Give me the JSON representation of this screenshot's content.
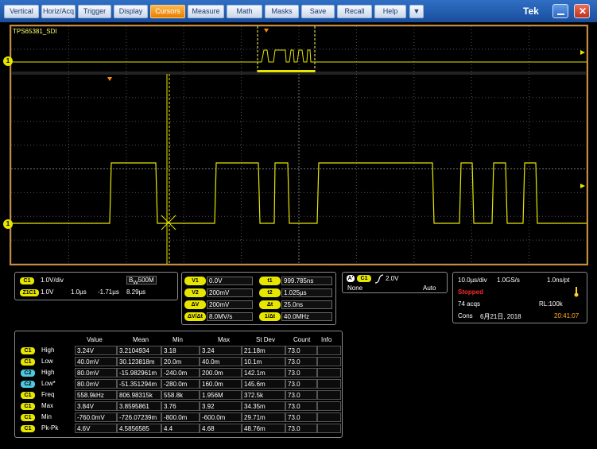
{
  "menu": [
    {
      "label": "Vertical",
      "name": "menu-vertical"
    },
    {
      "label": "Horiz/Acq",
      "name": "menu-horiz-acq"
    },
    {
      "label": "Trigger",
      "name": "menu-trigger"
    },
    {
      "label": "Display",
      "name": "menu-display"
    },
    {
      "label": "Cursors",
      "name": "menu-cursors",
      "active": true
    },
    {
      "label": "Measure",
      "name": "menu-measure"
    },
    {
      "label": "Math",
      "name": "menu-math"
    },
    {
      "label": "Masks",
      "name": "menu-masks"
    },
    {
      "label": "Save",
      "name": "menu-save"
    },
    {
      "label": "Recall",
      "name": "menu-recall"
    },
    {
      "label": "Help",
      "name": "menu-help"
    }
  ],
  "menu_more": "▼",
  "brand": "Tek",
  "screen": {
    "channel_name": "TPS65381_SDI",
    "channel_marker": "1",
    "trace_color": "#e6e600",
    "border_color": "#c88a3a"
  },
  "vertical": {
    "ch_badge": "C1",
    "volts_div": "1.0V/div",
    "bw": "500M",
    "zoom_badge": "Z1C1",
    "zoom_volts": "1.0V",
    "zoom_time": "1.0µs",
    "zoom_pos": "-1.71µs",
    "zoom_width": "8.29µs"
  },
  "cursors": {
    "v1_label": "V1",
    "v1": "0.0V",
    "v2_label": "V2",
    "v2": "200mV",
    "dv_label": "ΔV",
    "dv": "200mV",
    "dvdt_label": "ΔV/Δt",
    "dvdt": "8.0MV/s",
    "t1_label": "t1",
    "t1": "999.785ns",
    "t2_label": "t2",
    "t2": "1.025µs",
    "dt_label": "Δt",
    "dt": "25.0ns",
    "inv_dt_label": "1/Δt",
    "inv_dt": "40.0MHz"
  },
  "trigger": {
    "source_badge_a": "A'",
    "source_badge": "C1",
    "level": "2.0V",
    "mode_left": "None",
    "mode_right": "Auto"
  },
  "acquisition": {
    "timebase": "10.0µs/div",
    "sample_rate": "1.0GS/s",
    "resolution": "1.0ns/pt",
    "state": "Stopped",
    "acqs": "74 acqs",
    "record_length": "RL:100k",
    "mode": "Cons",
    "date": "6月21日, 2018",
    "time": "20:41:07"
  },
  "measurements": {
    "headers": [
      "Value",
      "Mean",
      "Min",
      "Max",
      "St Dev",
      "Count",
      "Info"
    ],
    "rows": [
      {
        "ch": "C1",
        "name": "High",
        "value": "3.24V",
        "mean": "3.2104934",
        "min": "3.18",
        "max": "3.24",
        "stdev": "21.18m",
        "count": "73.0"
      },
      {
        "ch": "C1",
        "name": "Low",
        "value": "40.0mV",
        "mean": "30.123818m",
        "min": "20.0m",
        "max": "40.0m",
        "stdev": "10.1m",
        "count": "73.0"
      },
      {
        "ch": "C2",
        "name": "High",
        "value": "80.0mV",
        "mean": "-15.982961m",
        "min": "-240.0m",
        "max": "200.0m",
        "stdev": "142.1m",
        "count": "73.0"
      },
      {
        "ch": "C2",
        "name": "Low*",
        "value": "80.0mV",
        "mean": "-51.351294m",
        "min": "-280.0m",
        "max": "160.0m",
        "stdev": "145.6m",
        "count": "73.0"
      },
      {
        "ch": "C1",
        "name": "Freq",
        "value": "558.9kHz",
        "mean": "806.98315k",
        "min": "558.8k",
        "max": "1.956M",
        "stdev": "372.5k",
        "count": "73.0"
      },
      {
        "ch": "C1",
        "name": "Max",
        "value": "3.84V",
        "mean": "3.8595861",
        "min": "3.76",
        "max": "3.92",
        "stdev": "34.35m",
        "count": "73.0"
      },
      {
        "ch": "C1",
        "name": "Min",
        "value": "-760.0mV",
        "mean": "-726.07239m",
        "min": "-800.0m",
        "max": "-600.0m",
        "stdev": "29.71m",
        "count": "73.0"
      },
      {
        "ch": "C1",
        "name": "Pk-Pk",
        "value": "4.6V",
        "mean": "4.5856585",
        "min": "4.4",
        "max": "4.68",
        "stdev": "48.76m",
        "count": "73.0"
      }
    ]
  }
}
